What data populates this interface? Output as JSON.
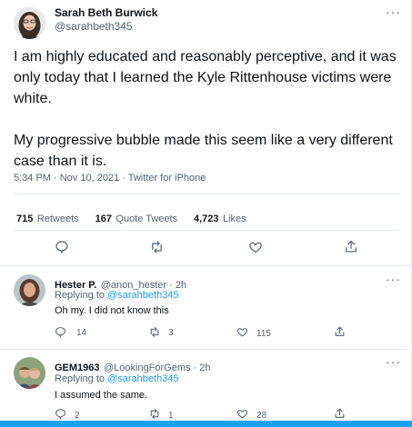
{
  "tweet": {
    "author_name": "Sarah Beth Burwick",
    "author_handle": "@sarahbeth345",
    "more_label": "···",
    "paragraph1": "I am highly educated and reasonably perceptive, and it was only today that I learned the Kyle Rittenhouse victims were white.",
    "paragraph2": "My progressive bubble made this seem like a very different case than it is.",
    "timestamp": "5:34 PM · Nov 10, 2021 · Twitter for iPhone",
    "stats": {
      "retweets_count": "715",
      "retweets_label": "Retweets",
      "quotes_count": "167",
      "quotes_label": "Quote Tweets",
      "likes_count": "4,723",
      "likes_label": "Likes"
    },
    "actions": [
      "reply-icon",
      "retweet-icon",
      "like-icon",
      "share-icon"
    ]
  },
  "replies": [
    {
      "name": "Hester P.",
      "handle": "@anon_hester · 2h",
      "replying_prefix": "Replying to",
      "replying_handle": "@sarahbeth345",
      "text": "Oh my. I did not know this",
      "reply_count": "14",
      "retweet_count": "3",
      "like_count": "115",
      "more_label": "···"
    },
    {
      "name": "GEM1963",
      "handle": "@LookingForGems · 2h",
      "replying_prefix": "Replying to",
      "replying_handle": "@sarahbeth345",
      "text": "I assumed the same.",
      "reply_count": "2",
      "retweet_count": "1",
      "like_count": "28",
      "more_label": "···"
    }
  ],
  "colors": {
    "accent": "#1d9bf0",
    "text": "#0f1419",
    "secondary": "#536471",
    "divider": "#e6ecf0",
    "bottom_bar": "#1da1f2"
  }
}
